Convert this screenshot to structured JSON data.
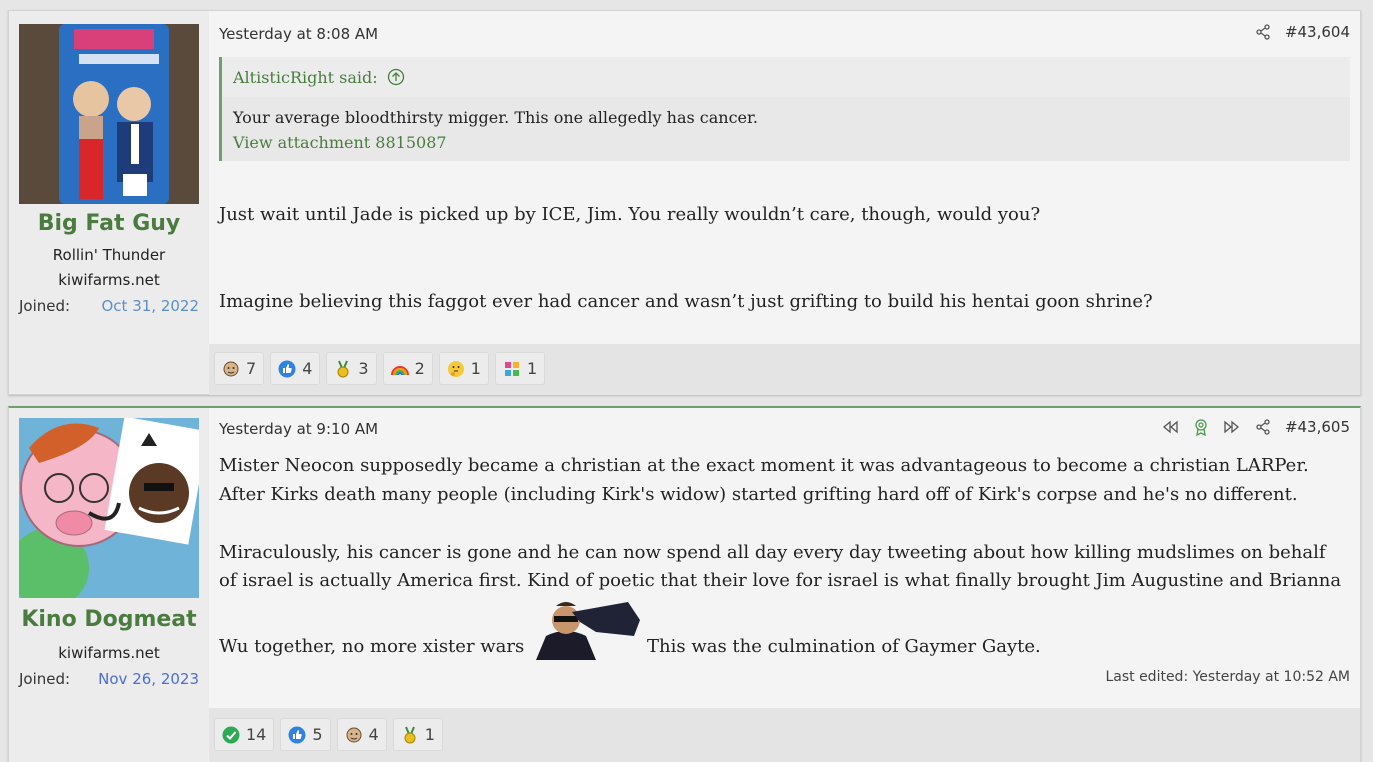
{
  "posts": [
    {
      "user": {
        "name": "Big Fat Guy",
        "title": "Rollin' Thunder",
        "site": "kiwifarms.net",
        "joined_label": "Joined:",
        "joined_date": "Oct 31, 2022",
        "avatar": "pez-dispenser-avatar"
      },
      "date": "Yesterday at 8:08 AM",
      "number": "#43,604",
      "quote": {
        "author": "AltisticRight said:",
        "text": "Your average bloodthirsty migger. This one allegedly has cancer.",
        "attachment": "View attachment 8815087"
      },
      "body": [
        "Just wait until Jade is picked up by ICE, Jim. You really wouldn’t care, though, would you?",
        "Imagine believing this faggot ever had cancer and wasn’t just grifting to build his hentai goon shrine?"
      ],
      "reactions": [
        {
          "icon": "face-icon",
          "count": "7"
        },
        {
          "icon": "like-icon",
          "count": "4"
        },
        {
          "icon": "medal-icon",
          "count": "3"
        },
        {
          "icon": "rainbow-icon",
          "count": "2"
        },
        {
          "icon": "thinking-icon",
          "count": "1"
        },
        {
          "icon": "puzzle-icon",
          "count": "1"
        }
      ]
    },
    {
      "user": {
        "name": "Kino Dogmeat",
        "site": "kiwifarms.net",
        "joined_label": "Joined:",
        "joined_date": "Nov 26, 2023",
        "avatar": "pig-cartoon-avatar"
      },
      "date": "Yesterday at 9:10 AM",
      "number": "#43,605",
      "body": [
        "Mister Neocon supposedly became a christian at the exact moment it was advantageous to become a christian LARPer.",
        "After Kirks death many people (including Kirk's widow) started grifting hard off of Kirk's corpse and he's no different.",
        "Miraculously, his cancer is gone and he can now spend all day every day tweeting about how killing mudslimes on behalf",
        "of israel is actually America first. Kind of poetic that their love for israel is what finally brought Jim Augustine and Brianna",
        "Wu together, no more xister wars",
        "This was the culmination of Gaymer Gayte."
      ],
      "last_edited": "Last edited: Yesterday at 10:52 AM",
      "reactions": [
        {
          "icon": "check-icon",
          "count": "14"
        },
        {
          "icon": "like-icon",
          "count": "5"
        },
        {
          "icon": "face-icon",
          "count": "4"
        },
        {
          "icon": "medal-icon",
          "count": "1"
        }
      ]
    }
  ],
  "colors": {
    "username": "#4a7c3f",
    "link": "#4a7c3f",
    "date_blue1": "#5a8fc8",
    "date_blue2": "#4a6ed8"
  }
}
